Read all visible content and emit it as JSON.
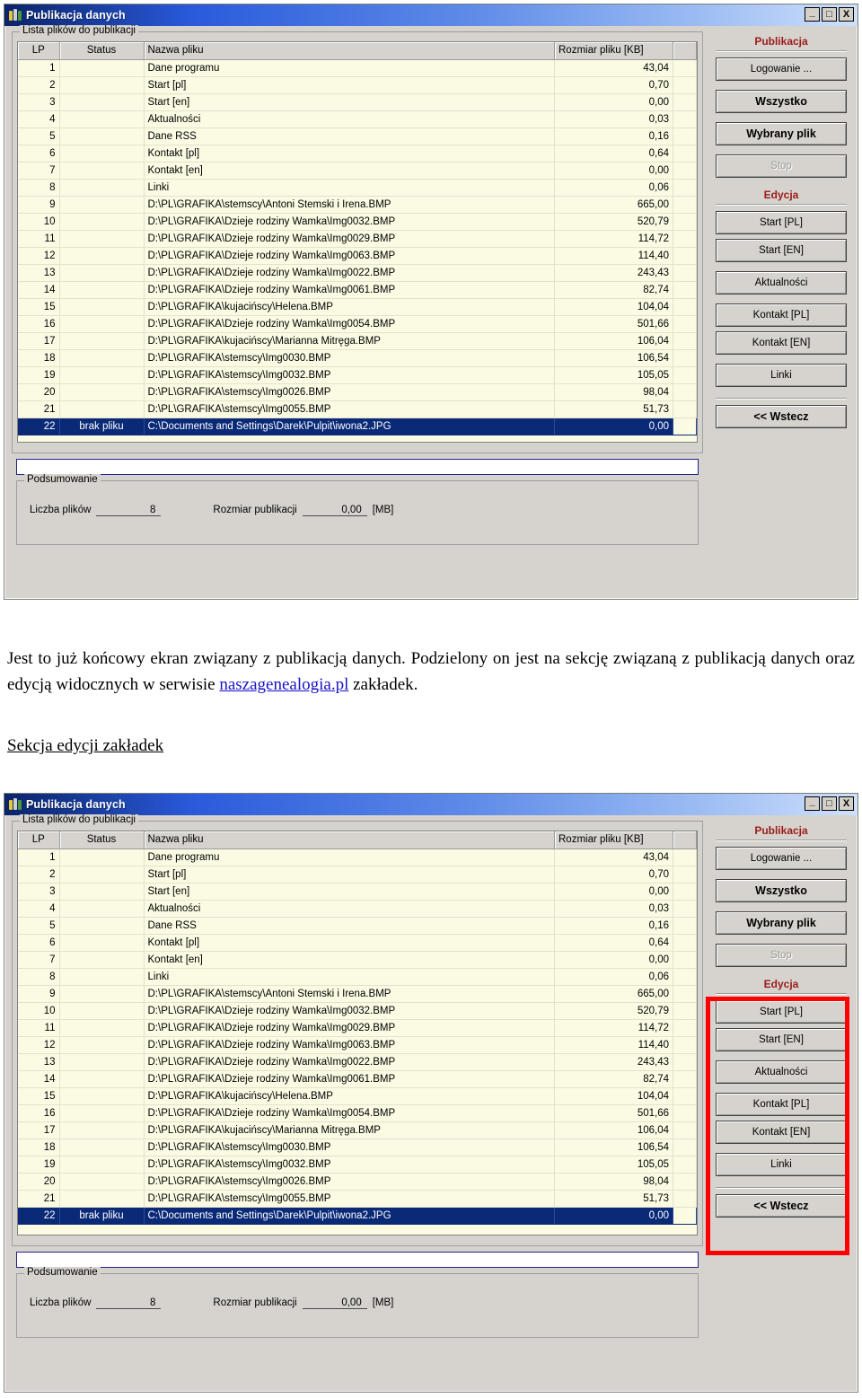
{
  "window": {
    "title": "Publikacja danych",
    "icon": "people-group-icon",
    "controls": {
      "minimize": "_",
      "maximize": "□",
      "close": "X"
    }
  },
  "list_group": {
    "legend": "Lista plików do publikacji"
  },
  "table": {
    "columns": [
      "LP",
      "Status",
      "Nazwa pliku",
      "Rozmiar pliku [KB]"
    ],
    "rows": [
      {
        "lp": "1",
        "status": "",
        "name": "Dane programu",
        "size": "43,04"
      },
      {
        "lp": "2",
        "status": "",
        "name": "Start [pl]",
        "size": "0,70"
      },
      {
        "lp": "3",
        "status": "",
        "name": "Start [en]",
        "size": "0,00"
      },
      {
        "lp": "4",
        "status": "",
        "name": "Aktualności",
        "size": "0,03"
      },
      {
        "lp": "5",
        "status": "",
        "name": "Dane RSS",
        "size": "0,16"
      },
      {
        "lp": "6",
        "status": "",
        "name": "Kontakt [pl]",
        "size": "0,64"
      },
      {
        "lp": "7",
        "status": "",
        "name": "Kontakt [en]",
        "size": "0,00"
      },
      {
        "lp": "8",
        "status": "",
        "name": "Linki",
        "size": "0,06"
      },
      {
        "lp": "9",
        "status": "",
        "name": "D:\\PL\\GRAFIKA\\stemscy\\Antoni Stemski i Irena.BMP",
        "size": "665,00"
      },
      {
        "lp": "10",
        "status": "",
        "name": "D:\\PL\\GRAFIKA\\Dzieje rodziny Wamka\\Img0032.BMP",
        "size": "520,79"
      },
      {
        "lp": "11",
        "status": "",
        "name": "D:\\PL\\GRAFIKA\\Dzieje rodziny Wamka\\Img0029.BMP",
        "size": "114,72"
      },
      {
        "lp": "12",
        "status": "",
        "name": "D:\\PL\\GRAFIKA\\Dzieje rodziny Wamka\\Img0063.BMP",
        "size": "114,40"
      },
      {
        "lp": "13",
        "status": "",
        "name": "D:\\PL\\GRAFIKA\\Dzieje rodziny Wamka\\Img0022.BMP",
        "size": "243,43"
      },
      {
        "lp": "14",
        "status": "",
        "name": "D:\\PL\\GRAFIKA\\Dzieje rodziny Wamka\\Img0061.BMP",
        "size": "82,74"
      },
      {
        "lp": "15",
        "status": "",
        "name": "D:\\PL\\GRAFIKA\\kujacińscy\\Helena.BMP",
        "size": "104,04"
      },
      {
        "lp": "16",
        "status": "",
        "name": "D:\\PL\\GRAFIKA\\Dzieje rodziny Wamka\\Img0054.BMP",
        "size": "501,66"
      },
      {
        "lp": "17",
        "status": "",
        "name": "D:\\PL\\GRAFIKA\\kujacińscy\\Marianna Mitręga.BMP",
        "size": "106,04"
      },
      {
        "lp": "18",
        "status": "",
        "name": "D:\\PL\\GRAFIKA\\stemscy\\Img0030.BMP",
        "size": "106,54"
      },
      {
        "lp": "19",
        "status": "",
        "name": "D:\\PL\\GRAFIKA\\stemscy\\Img0032.BMP",
        "size": "105,05"
      },
      {
        "lp": "20",
        "status": "",
        "name": "D:\\PL\\GRAFIKA\\stemscy\\Img0026.BMP",
        "size": "98,04"
      },
      {
        "lp": "21",
        "status": "",
        "name": "D:\\PL\\GRAFIKA\\stemscy\\Img0055.BMP",
        "size": "51,73"
      },
      {
        "lp": "22",
        "status": "brak pliku",
        "name": "C:\\Documents and Settings\\Darek\\Pulpit\\iwona2.JPG",
        "size": "0,00",
        "selected": true
      }
    ]
  },
  "summary": {
    "legend": "Podsumowanie",
    "count_label": "Liczba plików",
    "count_value": "8",
    "size_label": "Rozmiar publikacji",
    "size_value": "0,00",
    "size_unit": "[MB]"
  },
  "sidebar": {
    "publication_title": "Publikacja",
    "edition_title": "Edycja",
    "buttons": {
      "login": "Logowanie ...",
      "all": "Wszystko",
      "selected_file": "Wybrany plik",
      "stop": "Stop",
      "start_pl": "Start [PL]",
      "start_en": "Start [EN]",
      "news": "Aktualności",
      "contact_pl": "Kontakt [PL]",
      "contact_en": "Kontakt [EN]",
      "links": "Linki",
      "back": "<< Wstecz"
    }
  },
  "prose": {
    "part1": "Jest to już końcowy ekran związany z publikacją danych. Podzielony on jest na sekcję związaną z publikacją danych oraz edycją widocznych w serwisie ",
    "link": "naszagenealogia.pl",
    "part2": " zakładek.",
    "subheading": "Sekcja edycji zakładek"
  },
  "colors": {
    "accent_red": "#9b1b1b",
    "highlight_red": "#ff0000",
    "selection_blue": "#0a2a78",
    "grid_background": "#fbfbe4",
    "chrome": "#d6d3ce",
    "link": "#1a12c8"
  }
}
